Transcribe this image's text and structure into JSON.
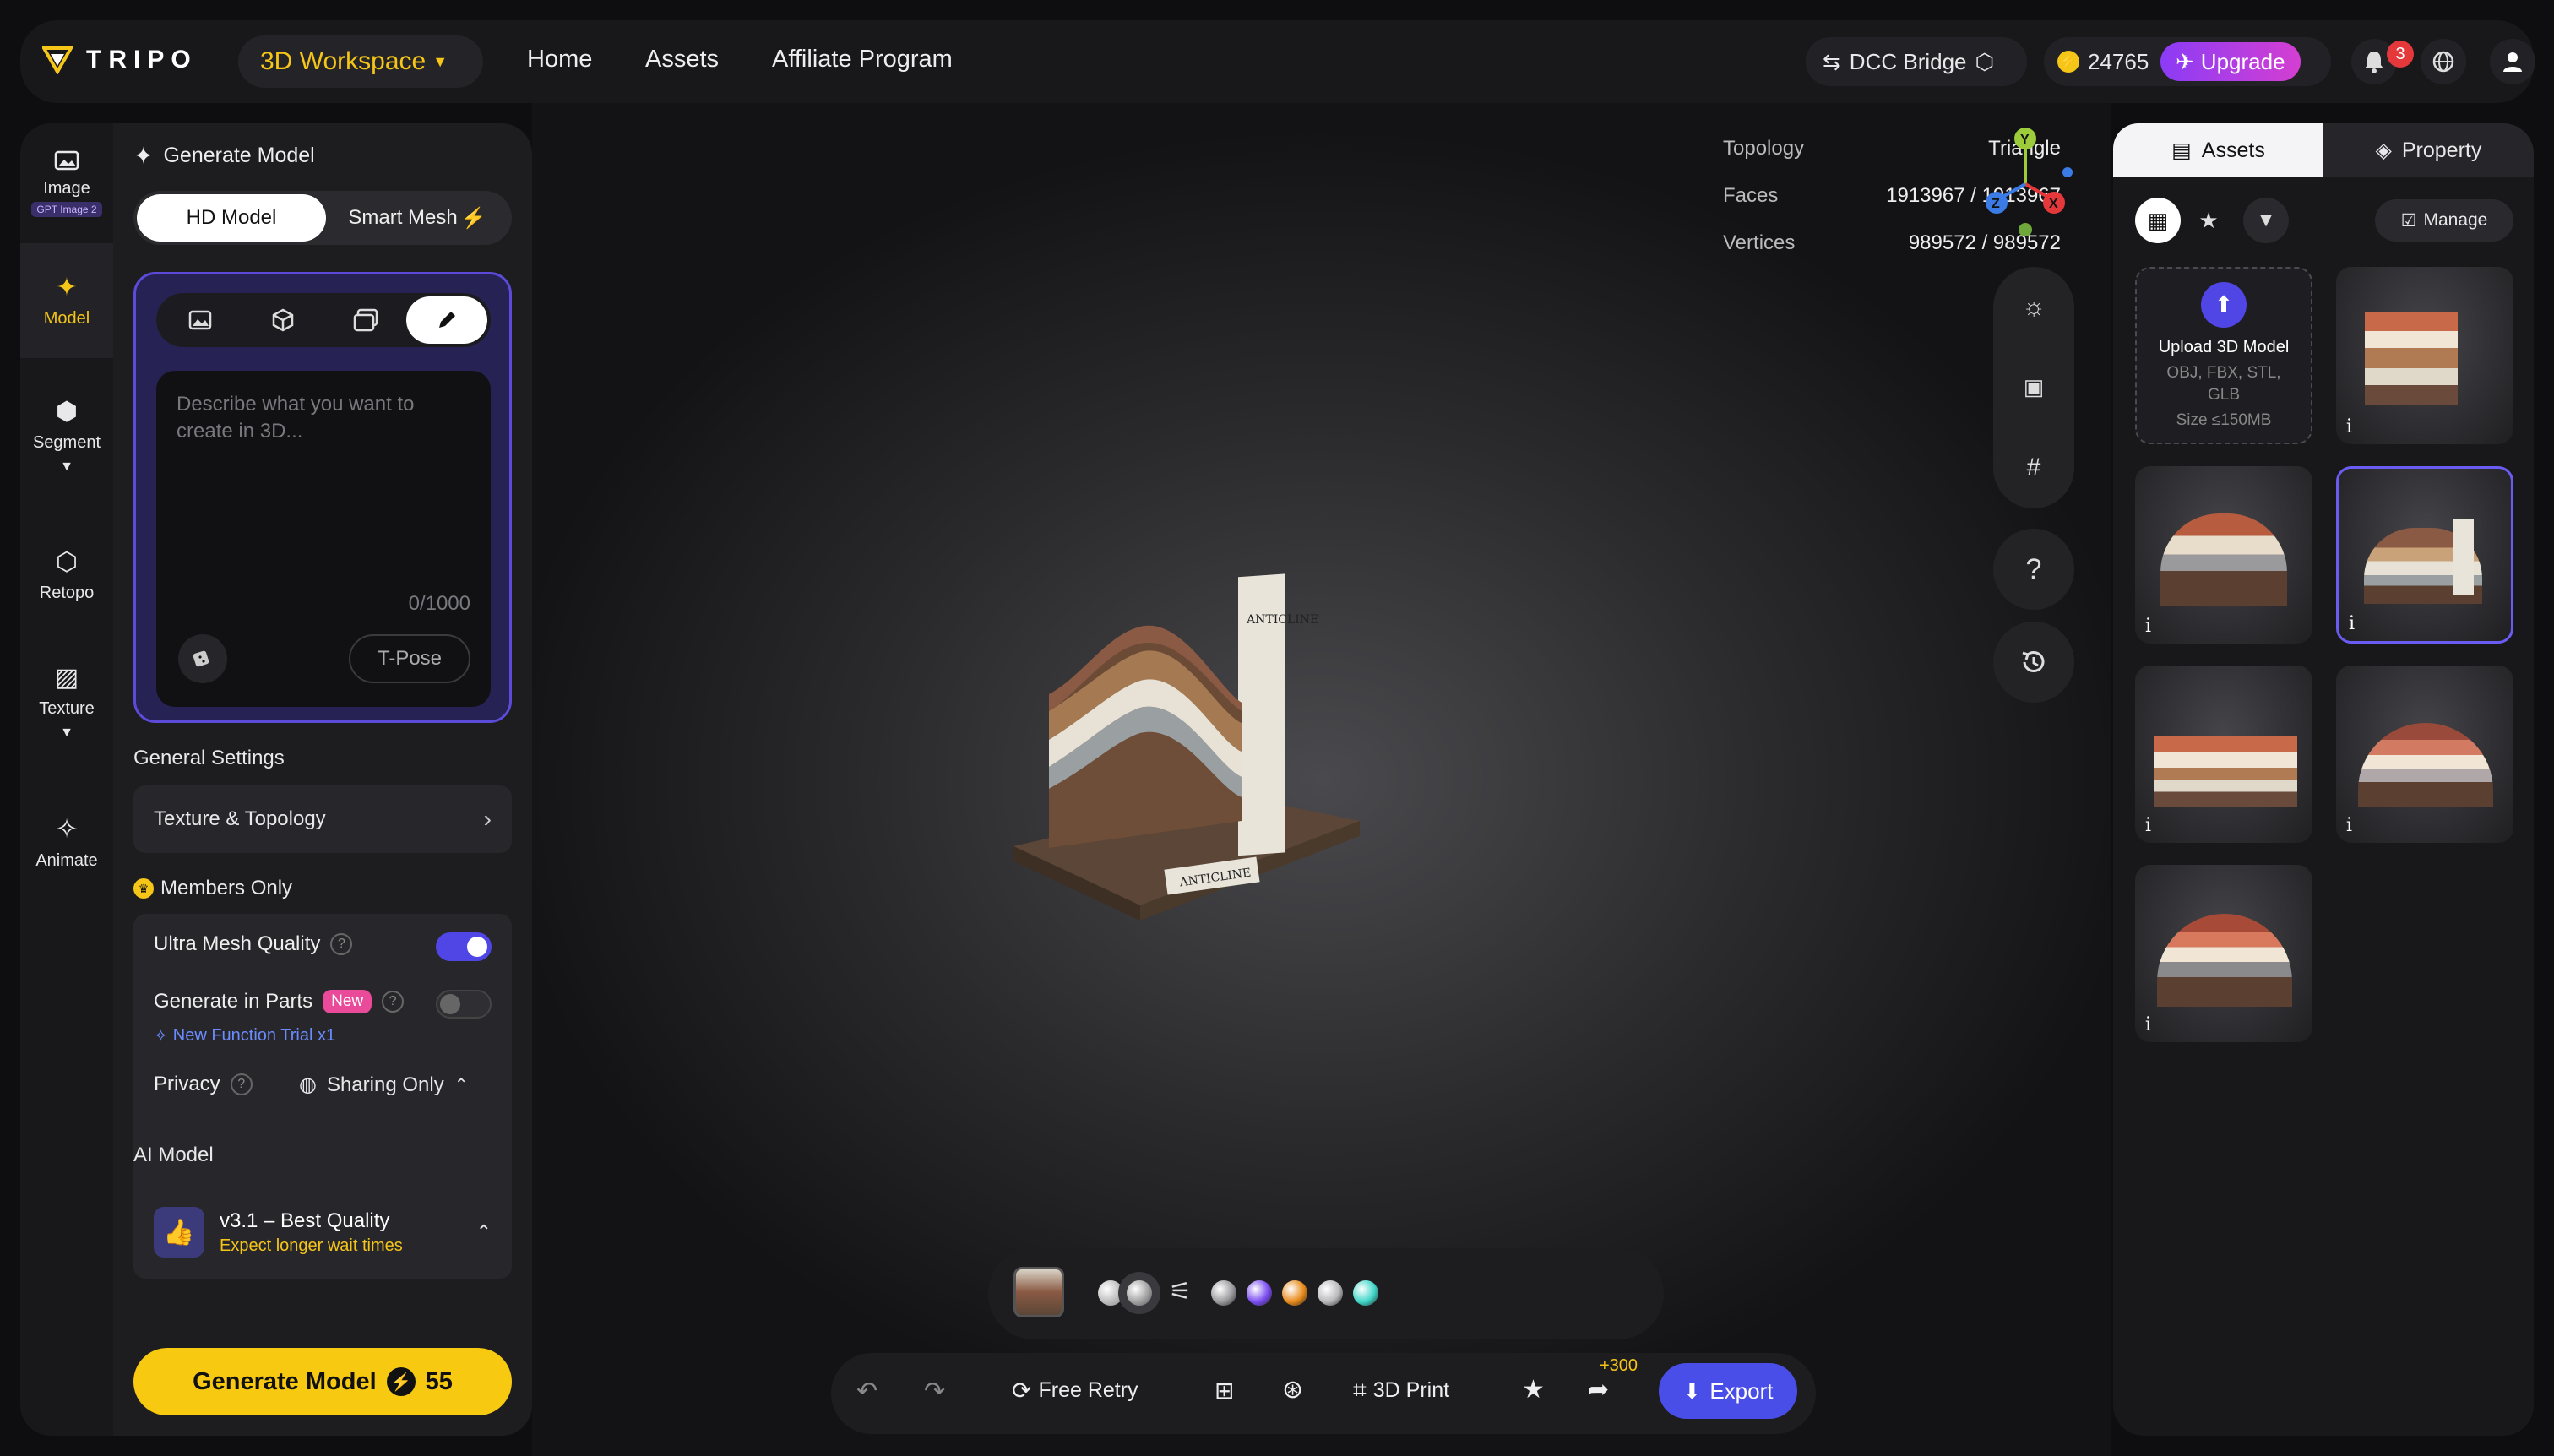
{
  "topbar": {
    "logo": "TRIPO",
    "workspace": "3D Workspace",
    "nav": [
      "Home",
      "Assets",
      "Affiliate Program"
    ],
    "dcc_bridge": "DCC Bridge",
    "credits": "24765",
    "upgrade": "Upgrade",
    "notification_count": "3"
  },
  "rail": {
    "image": "Image",
    "image_badge": "GPT Image 2",
    "model": "Model",
    "segment": "Segment",
    "retopo": "Retopo",
    "texture": "Texture",
    "animate": "Animate"
  },
  "panel": {
    "title": "Generate Model",
    "tab_hd": "HD Model",
    "tab_smart": "Smart Mesh",
    "prompt_placeholder": "Describe what you want to create in 3D...",
    "counter": "0/1000",
    "tpose": "T-Pose",
    "general_settings": "General Settings",
    "texture_topology": "Texture & Topology",
    "members_only": "Members Only",
    "ultra_mesh": "Ultra Mesh Quality",
    "ultra_mesh_on": true,
    "generate_parts": "Generate in Parts",
    "new_badge": "New",
    "new_function": "New Function Trial x1",
    "privacy": "Privacy",
    "sharing": "Sharing Only",
    "ai_model_label": "AI Model",
    "model_name": "v3.1 – Best Quality",
    "model_note": "Expect longer wait times",
    "generate_button": "Generate Model",
    "generate_cost": "55"
  },
  "viewer": {
    "topology_label": "Topology",
    "topology_value": "Triangle",
    "faces_label": "Faces",
    "faces_value": "1913967 / 1913967",
    "vertices_label": "Vertices",
    "vertices_value": "989572 / 989572",
    "axis_y": "Y",
    "axis_z": "Z",
    "axis_x": "X",
    "help": "?",
    "model_sign": "ANTICLINE",
    "model_plaque": "ANTICLINE"
  },
  "materials": {
    "sphere_colors": [
      "#9a9a9e",
      "#7a4cf0",
      "#e88a1a",
      "#b8b8bc",
      "#40d6c8"
    ]
  },
  "actions": {
    "free_retry": "Free Retry",
    "print": "3D Print",
    "share_bonus": "+300",
    "export": "Export"
  },
  "assets": {
    "tab_assets": "Assets",
    "tab_property": "Property",
    "manage": "Manage",
    "upload_title": "Upload 3D Model",
    "upload_formats": "OBJ, FBX, STL, GLB",
    "upload_size": "Size ≤150MB",
    "info": "i"
  }
}
